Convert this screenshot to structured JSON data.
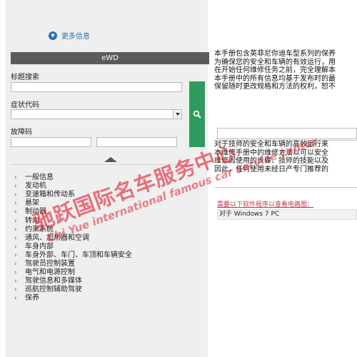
{
  "header": {
    "more_info_label": "更多信息"
  },
  "panel": {
    "title": "eWD",
    "fields": {
      "title_search_label": "标题搜索",
      "symptom_code_label": "症状代码",
      "fault_code_label": "故障码"
    }
  },
  "nav": {
    "items": [
      "一般信息",
      "发动机",
      "变速箱和传动系",
      "悬架",
      "制动器",
      "转向",
      "约束系统",
      "通风、加热器和空调",
      "车身内部",
      "车身外部、车门、车顶和车辆安全",
      "驾驶员控制装置",
      "电气和电源控制",
      "驾驶信息和多媒体",
      "巡航控制辅助驾驶",
      "保养"
    ]
  },
  "right": {
    "intro_lines": [
      "本手册包含英菲尼你迪车型系列的保养",
      "为确保您的安全和车辆的有效运行，用",
      "在开始任何维修任务之前，完全理解本",
      "本手册中的所有信息均基于发布时的最",
      "保留随时更改规格和方法的权利，恕不"
    ],
    "safety_lines": [
      "对于技师的安全和车辆的高效运行来",
      "本维修手册中的维修方法以可以安全",
      "维修因使用的步骤、技师的技能以及",
      "因此，任何使用未经日产专门推荐的"
    ],
    "software_link": "需要以下软件程序以查看电路图：",
    "os_row": "对于 Windows 7 PC"
  },
  "watermark": {
    "main": "驰跃国际名车服务中心",
    "sub": "Chi Yue international famous car service center"
  }
}
